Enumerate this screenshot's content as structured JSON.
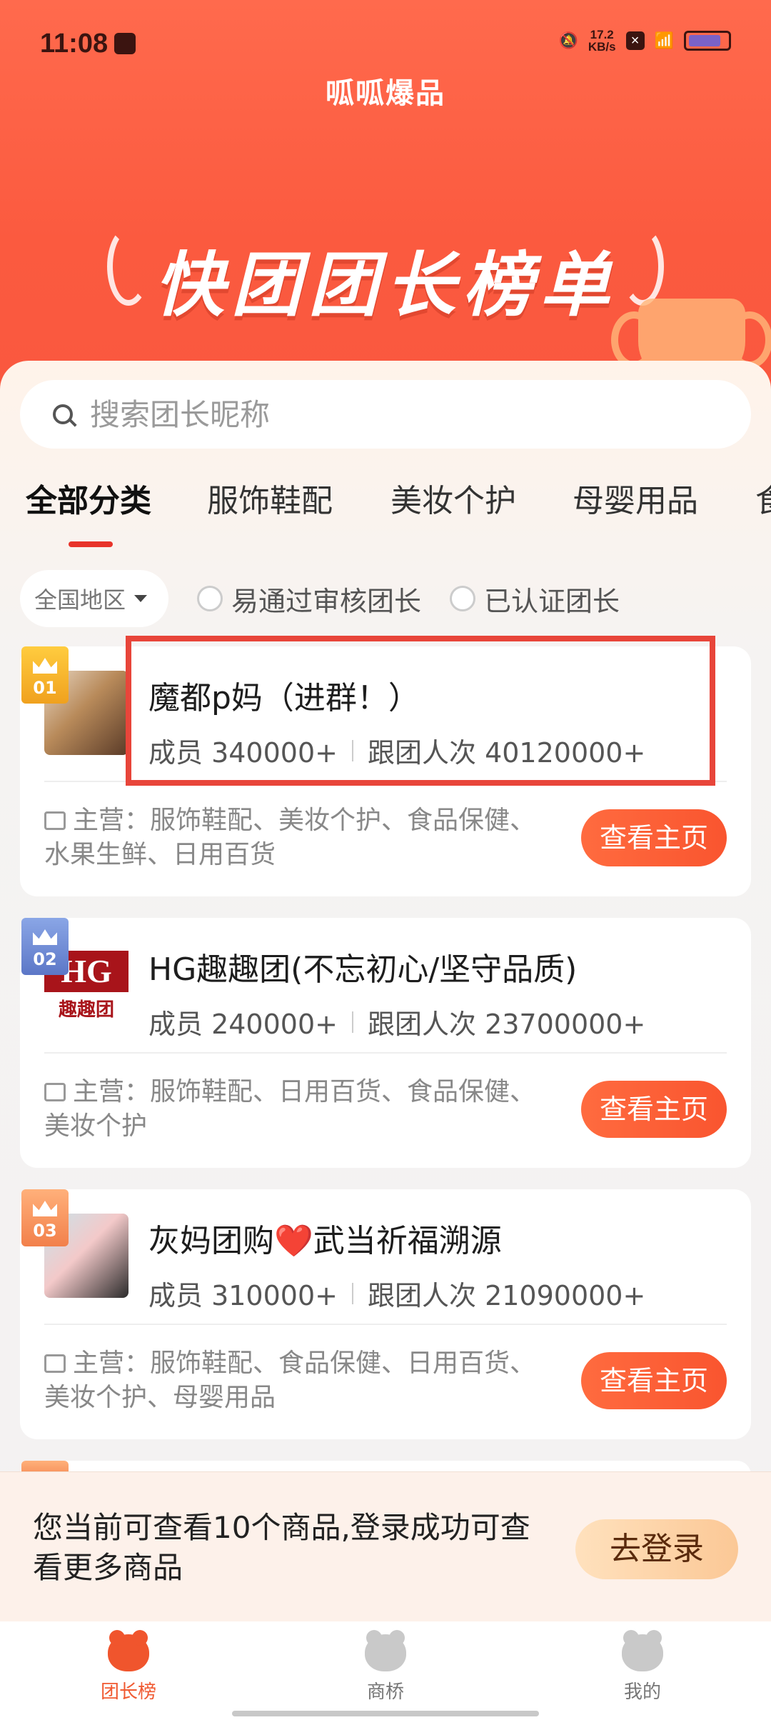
{
  "status": {
    "time": "11:08",
    "net_rate": "17.2\nKB/s"
  },
  "app": {
    "title": "呱呱爆品",
    "banner": "快团团长榜单"
  },
  "search": {
    "placeholder": "搜索团长昵称"
  },
  "tabs": [
    "全部分类",
    "服饰鞋配",
    "美妆个护",
    "母婴用品",
    "食"
  ],
  "filters": {
    "region": "全国地区",
    "option1": "易通过审核团长",
    "option2": "已认证团长"
  },
  "cards": [
    {
      "rank": "01",
      "name": "魔都p妈（进群！）",
      "members": "成员 340000+",
      "joins": "跟团人次 40120000+",
      "main": "主营：服饰鞋配、美妆个护、食品保健、水果生鲜、日用百货",
      "button": "查看主页"
    },
    {
      "rank": "02",
      "name": "HG趣趣团(不忘初心/坚守品质)",
      "members": "成员 240000+",
      "joins": "跟团人次 23700000+",
      "main": "主营：服饰鞋配、日用百货、食品保健、美妆个护",
      "button": "查看主页",
      "logo": "HG",
      "logo_sub": "趣趣团"
    },
    {
      "rank": "03",
      "name": "灰妈团购❤️武当祈福溯源",
      "members": "成员 310000+",
      "joins": "跟团人次 21090000+",
      "main": "主营：服饰鞋配、食品保健、日用百货、美妆个护、母婴用品",
      "button": "查看主页"
    }
  ],
  "login": {
    "text": "您当前可查看10个商品,登录成功可查看更多商品",
    "button": "去登录"
  },
  "nav": [
    "团长榜",
    "商桥",
    "我的"
  ]
}
